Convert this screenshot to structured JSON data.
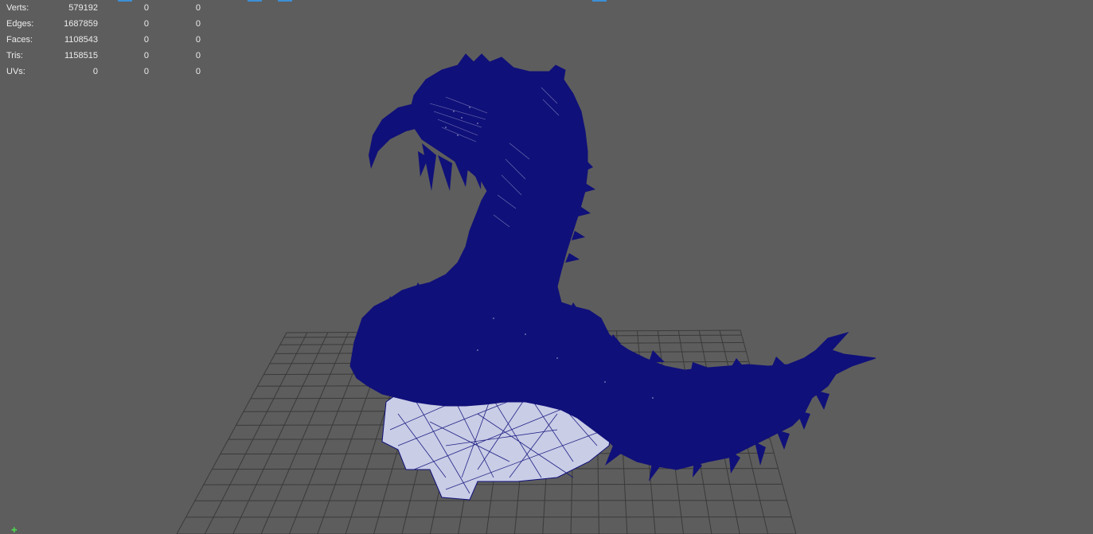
{
  "hud": {
    "rows": [
      {
        "label": "Verts:",
        "v1": "579192",
        "v2": "0",
        "v3": "0"
      },
      {
        "label": "Edges:",
        "v1": "1687859",
        "v2": "0",
        "v3": "0"
      },
      {
        "label": "Faces:",
        "v1": "1108543",
        "v2": "0",
        "v3": "0"
      },
      {
        "label": "Tris:",
        "v1": "1158515",
        "v2": "0",
        "v3": "0"
      },
      {
        "label": "UVs:",
        "v1": "0",
        "v2": "0",
        "v3": "0"
      }
    ]
  },
  "colors": {
    "viewport_background": "#5d5d5d",
    "grid": "#3a3a3a",
    "wireframe": "#10107a",
    "highlight_strip": "#3d8fd6",
    "axis_indicator": "#4fd14f"
  },
  "icons": {
    "axis": "axis-indicator-icon"
  }
}
